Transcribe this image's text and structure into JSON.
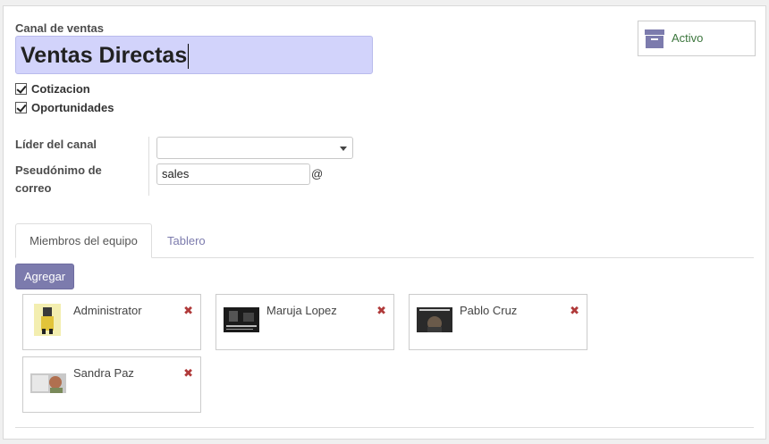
{
  "form": {
    "channel_label": "Canal de ventas",
    "channel_name": "Ventas Directas",
    "checkboxes": [
      {
        "label": "Cotizacion",
        "checked": true
      },
      {
        "label": "Oportunidades",
        "checked": true
      }
    ],
    "leader_label": "Líder del canal",
    "leader_value": "",
    "alias_label_line1": "Pseudónimo de",
    "alias_label_line2": "correo",
    "alias_value": "sales",
    "alias_suffix": "@"
  },
  "status_button": {
    "label": "Activo",
    "icon": "archive-icon"
  },
  "tabs": [
    {
      "label": "Miembros del equipo",
      "active": true
    },
    {
      "label": "Tablero",
      "active": false
    }
  ],
  "add_button_label": "Agregar",
  "members": [
    {
      "name": "Administrator",
      "remove_icon": "✖"
    },
    {
      "name": "Maruja Lopez",
      "remove_icon": "✖"
    },
    {
      "name": "Pablo Cruz",
      "remove_icon": "✖"
    },
    {
      "name": "Sandra Paz",
      "remove_icon": "✖"
    }
  ],
  "colors": {
    "accent": "#7c7bad",
    "active_text": "#3c763d",
    "remove": "#b03a3a",
    "highlight": "#d2d3fb"
  }
}
